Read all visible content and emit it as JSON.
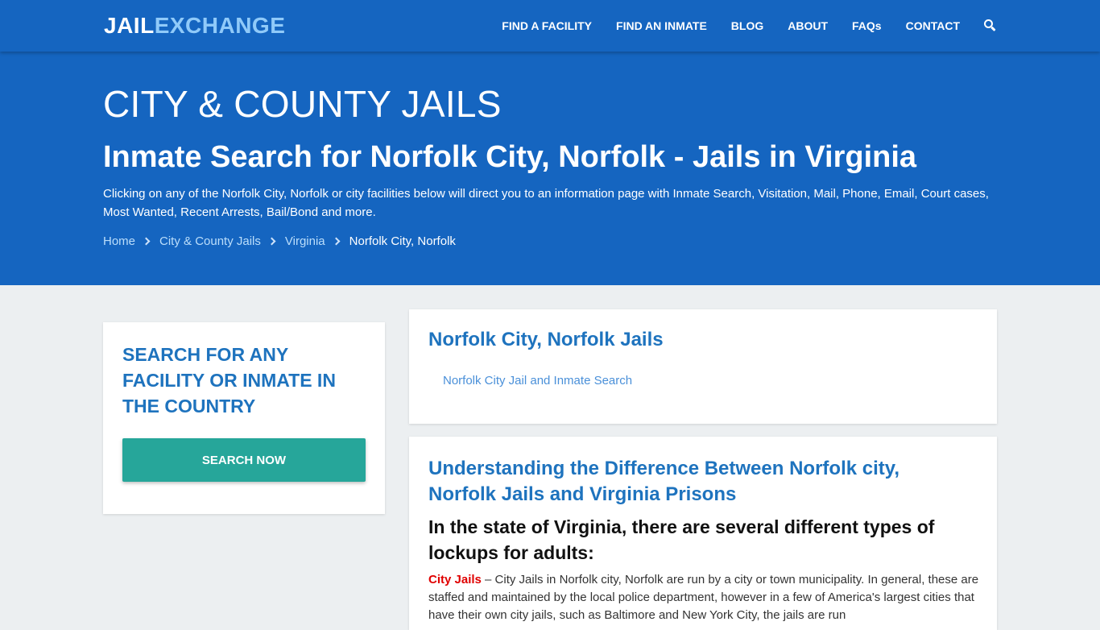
{
  "nav": {
    "logo_part1": "JAIL",
    "logo_part2": "EXCHANGE",
    "items": [
      "FIND A FACILITY",
      "FIND AN INMATE",
      "BLOG",
      "ABOUT",
      "FAQs",
      "CONTACT"
    ],
    "search_icon": "search-icon"
  },
  "hero": {
    "kicker": "CITY & COUNTY JAILS",
    "title": "Inmate Search for Norfolk City, Norfolk - Jails in Virginia",
    "description": "Clicking on any of the Norfolk City, Norfolk or city facilities below will direct you to an information page with Inmate Search, Visitation, Mail, Phone, Email, Court cases, Most Wanted, Recent Arrests, Bail/Bond and more.",
    "breadcrumb": [
      "Home",
      "City & County Jails",
      "Virginia"
    ],
    "breadcrumb_current": "Norfolk City, Norfolk"
  },
  "sidebar": {
    "heading": "SEARCH FOR ANY FACILITY OR INMATE IN THE COUNTRY",
    "button": "SEARCH NOW"
  },
  "jails_card": {
    "title": "Norfolk City, Norfolk Jails",
    "link": "Norfolk City Jail and Inmate Search"
  },
  "info_card": {
    "title": "Understanding the Difference Between Norfolk city, Norfolk Jails and Virginia Prisons",
    "subtitle": "In the state of Virginia, there are several different types of lockups for adults:",
    "term": "City Jails",
    "body": " – City Jails in Norfolk city, Norfolk are run by a city or town municipality. In general, these are staffed and maintained by the local police department, however in a few of America's largest cities that have their own city jails, such as Baltimore and New York City, the jails are run"
  },
  "colors": {
    "primary": "#1565c0",
    "logo_accent": "#90caf9",
    "link": "#1e73be",
    "button": "#26a69a",
    "term": "#e00000",
    "background": "#eceff1"
  }
}
